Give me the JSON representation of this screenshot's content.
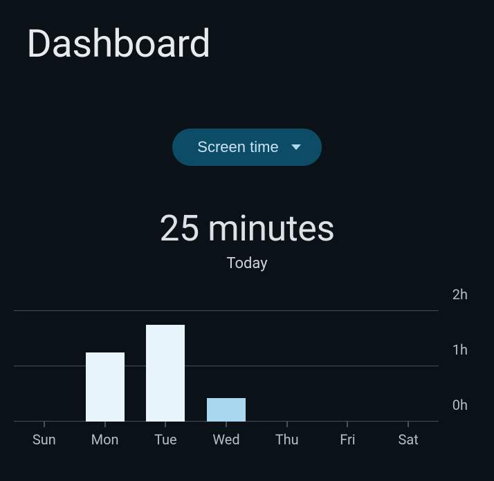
{
  "page_title": "Dashboard",
  "dropdown": {
    "selected_label": "Screen time"
  },
  "summary": {
    "value": "25 minutes",
    "label": "Today"
  },
  "chart_data": {
    "type": "bar",
    "categories": [
      "Sun",
      "Mon",
      "Tue",
      "Wed",
      "Thu",
      "Fri",
      "Sat"
    ],
    "values": [
      0,
      1.25,
      1.75,
      0.42,
      0,
      0,
      0
    ],
    "title": "Screen time",
    "xlabel": "",
    "ylabel": "",
    "ylim": [
      0,
      2
    ],
    "y_ticks": [
      {
        "value": 0,
        "label": "0h"
      },
      {
        "value": 1,
        "label": "1h"
      },
      {
        "value": 2,
        "label": "2h"
      }
    ],
    "highlight_index": 3
  }
}
